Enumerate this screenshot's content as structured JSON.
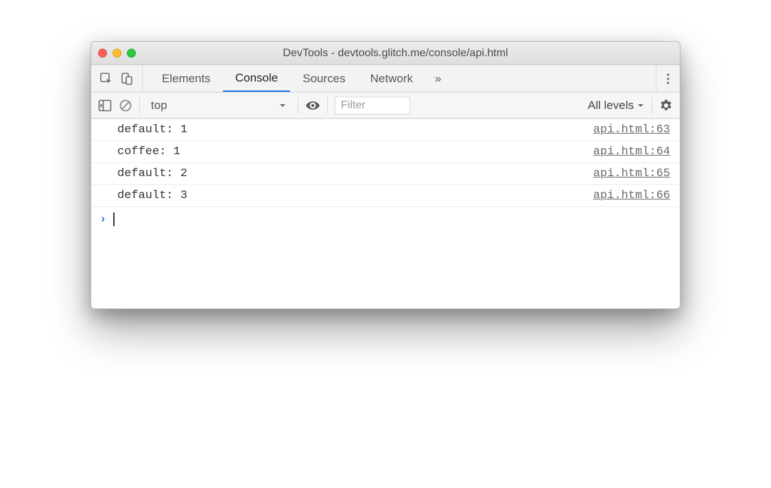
{
  "window": {
    "title": "DevTools - devtools.glitch.me/console/api.html"
  },
  "tabs": {
    "items": [
      "Elements",
      "Console",
      "Sources",
      "Network"
    ],
    "active_index": 1,
    "overflow_glyph": "»"
  },
  "toolbar": {
    "context": "top",
    "filter_placeholder": "Filter",
    "levels_label": "All levels"
  },
  "messages": [
    {
      "text": "default: 1",
      "source": "api.html:63"
    },
    {
      "text": "coffee: 1",
      "source": "api.html:64"
    },
    {
      "text": "default: 2",
      "source": "api.html:65"
    },
    {
      "text": "default: 3",
      "source": "api.html:66"
    }
  ],
  "prompt": {
    "chevron": "›"
  }
}
